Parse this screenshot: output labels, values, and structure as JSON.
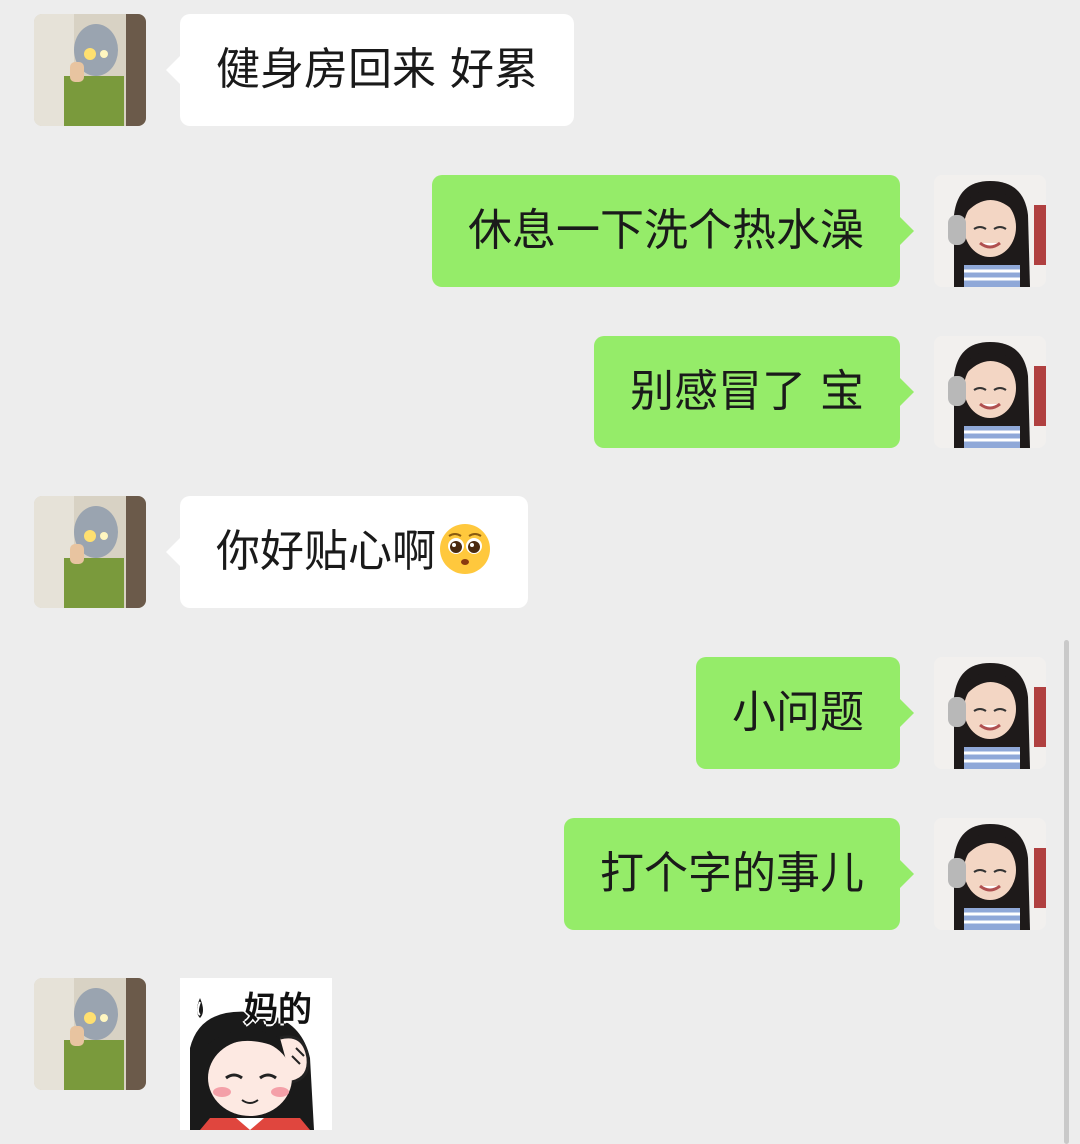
{
  "messages": [
    {
      "side": "in",
      "text": "健身房回来 好累"
    },
    {
      "side": "out",
      "text": "休息一下洗个热水澡"
    },
    {
      "side": "out",
      "text": "别感冒了 宝"
    },
    {
      "side": "in",
      "text": "你好贴心啊",
      "emoji": "pleading-face-emoji"
    },
    {
      "side": "out",
      "text": "小问题"
    },
    {
      "side": "out",
      "text": "打个字的事儿"
    },
    {
      "side": "in",
      "sticker_text": "妈的"
    }
  ],
  "colors": {
    "background": "#ededed",
    "incoming_bubble": "#ffffff",
    "outgoing_bubble": "#95ec69"
  }
}
